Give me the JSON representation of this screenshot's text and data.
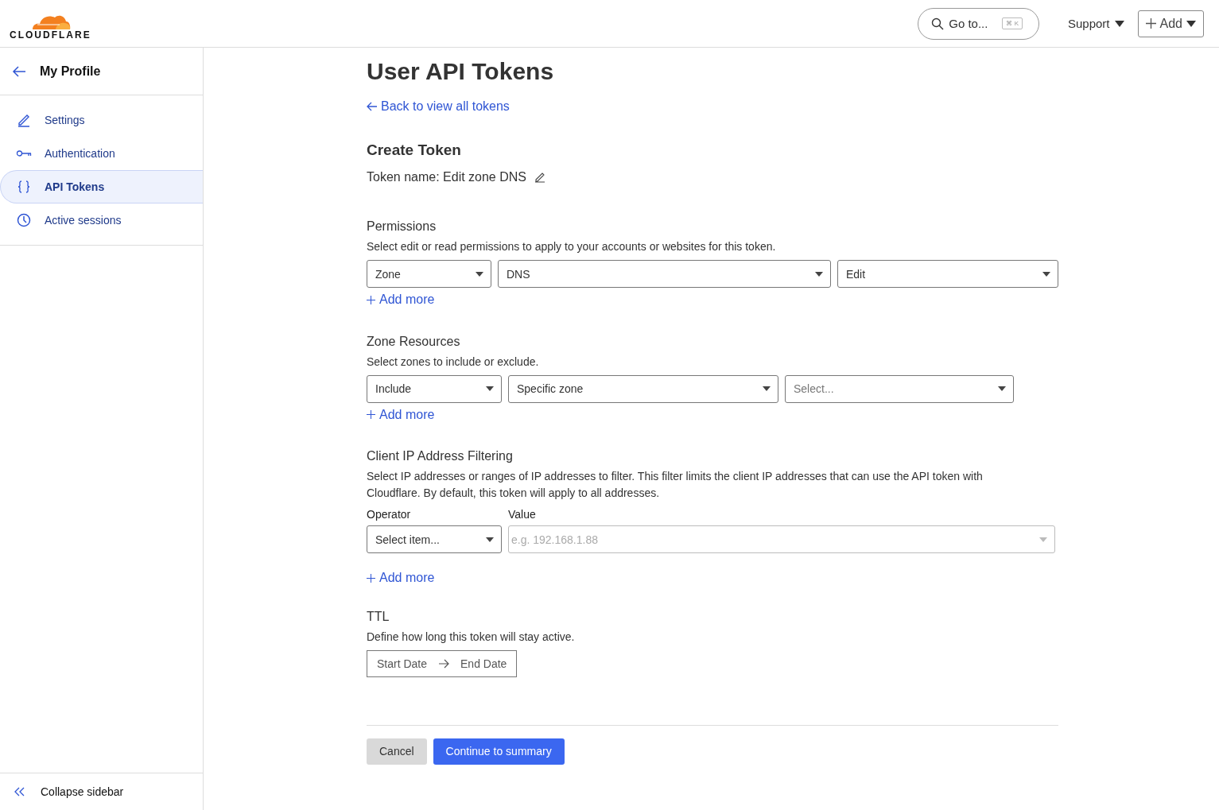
{
  "header": {
    "logo": "CLOUDFLARE",
    "search": {
      "label": "Go to...",
      "shortcut": "⌘ K"
    },
    "support": "Support",
    "add": "Add"
  },
  "sidebar": {
    "title": "My Profile",
    "items": [
      {
        "label": "Settings",
        "kind": "pencil",
        "selected": false
      },
      {
        "label": "Authentication",
        "kind": "key",
        "selected": false
      },
      {
        "label": "API Tokens",
        "kind": "braces",
        "selected": true
      },
      {
        "label": "Active sessions",
        "kind": "clock",
        "selected": false
      }
    ],
    "collapse": "Collapse sidebar"
  },
  "main": {
    "title": "User API Tokens",
    "back_link": "Back to view all tokens",
    "heading": "Create Token",
    "token_name": "Token name: Edit zone DNS",
    "sections": [
      {
        "kind": "selects",
        "title": "Permissions",
        "description": "Select edit or read permissions to apply to your accounts or websites for this token.",
        "selects": [
          {
            "value": "Zone"
          },
          {
            "value": "DNS"
          },
          {
            "value": "Edit"
          }
        ],
        "add_more": "Add more"
      },
      {
        "kind": "selects",
        "title": "Zone Resources",
        "description": "Select zones to include or exclude.",
        "selects": [
          {
            "value": "Include"
          },
          {
            "value": "Specific zone"
          },
          {
            "placeholder": "Select..."
          }
        ],
        "add_more": "Add more"
      },
      {
        "kind": "ip",
        "title": "Client IP Address Filtering",
        "description": "Select IP addresses or ranges of IP addresses to filter. This filter limits the client IP addresses that can use the API token with Cloudflare. By default, this token will apply to all addresses.",
        "operator_label": "Operator",
        "operator": {
          "value": "Select item..."
        },
        "value_label": "Value",
        "value": {
          "placeholder": "e.g. 192.168.1.88"
        },
        "add_more": "Add more"
      },
      {
        "kind": "dates",
        "title": "TTL",
        "description": "Define how long this token will stay active.",
        "start": "Start Date",
        "end": "End Date"
      }
    ],
    "buttons": [
      {
        "label": "Cancel",
        "kind": "secondary"
      },
      {
        "label": "Continue to summary",
        "kind": "primary"
      }
    ]
  }
}
